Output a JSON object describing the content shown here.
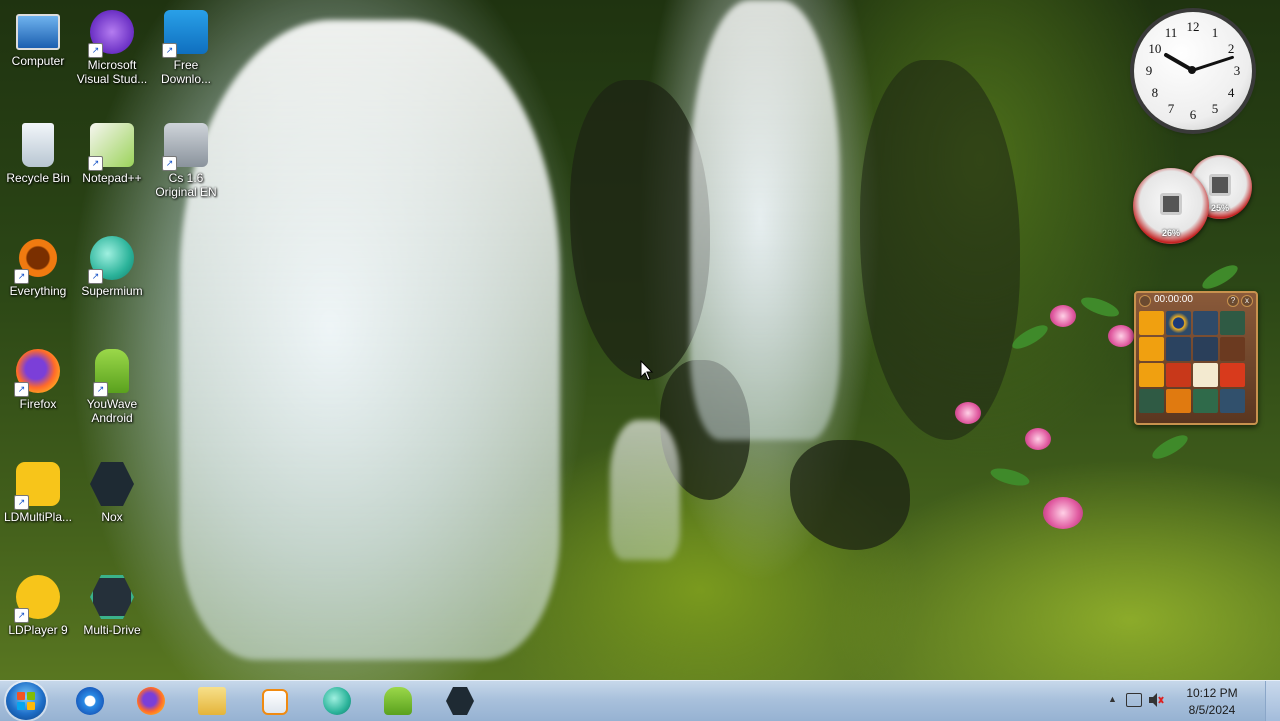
{
  "desktop_icons": [
    {
      "label": "Computer"
    },
    {
      "label": "Microsoft\nVisual Stud..."
    },
    {
      "label": "Free\nDownlo..."
    },
    {
      "label": "Recycle Bin"
    },
    {
      "label": "Notepad++"
    },
    {
      "label": "Cs 1.6\nOriginal EN"
    },
    {
      "label": "Everything"
    },
    {
      "label": "Supermium"
    },
    {
      "label": "Firefox"
    },
    {
      "label": "YouWave\nAndroid"
    },
    {
      "label": "LDMultiPla..."
    },
    {
      "label": "Nox"
    },
    {
      "label": "LDPlayer 9"
    },
    {
      "label": "Multi-Drive"
    }
  ],
  "gadgets": {
    "clock_numbers": [
      "12",
      "1",
      "2",
      "3",
      "4",
      "5",
      "6",
      "7",
      "8",
      "9",
      "10",
      "11"
    ],
    "cpu_meter": {
      "percent": "26%",
      "value": 26
    },
    "memory_meter": {
      "percent": "25%",
      "value": 25
    },
    "puzzle": {
      "timer": "00:00:00",
      "help": "?",
      "close": "x"
    }
  },
  "taskbar": {
    "pinned": [
      {
        "icon": "internet-explorer-icon"
      },
      {
        "icon": "firefox-icon"
      },
      {
        "icon": "file-explorer-icon"
      },
      {
        "icon": "media-player-icon"
      },
      {
        "icon": "supermium-icon"
      },
      {
        "icon": "youwave-android-icon"
      },
      {
        "icon": "nox-icon"
      }
    ],
    "tray": {
      "time": "10:12 PM",
      "date": "8/5/2024",
      "show_hidden": "▲"
    }
  },
  "colors": {
    "taskbar": "#a9c1dc",
    "start_orb": "#1f6fc8"
  }
}
